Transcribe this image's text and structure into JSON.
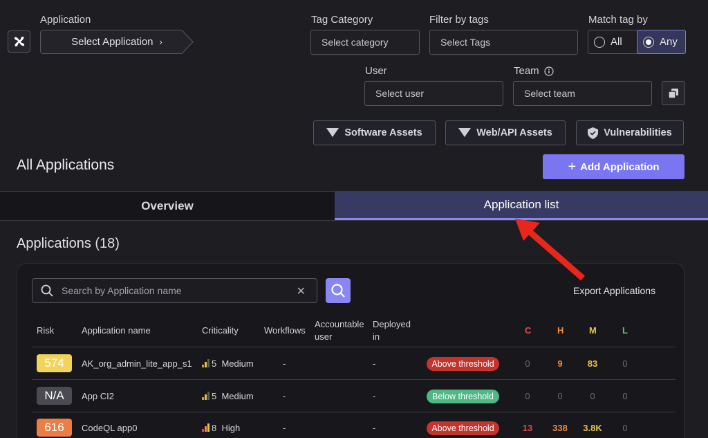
{
  "filters": {
    "application_label": "Application",
    "application_value": "Select Application",
    "tag_category_label": "Tag Category",
    "tag_category_placeholder": "Select category",
    "filter_tags_label": "Filter by tags",
    "filter_tags_placeholder": "Select Tags",
    "match_label": "Match tag by",
    "match_all": "All",
    "match_any": "Any",
    "user_label": "User",
    "user_placeholder": "Select user",
    "team_label": "Team",
    "team_placeholder": "Select team"
  },
  "asset_buttons": {
    "software": "Software Assets",
    "webapi": "Web/API Assets",
    "vulns": "Vulnerabilities"
  },
  "page_title": "All Applications",
  "add_button": "Add Application",
  "tabs": {
    "overview": "Overview",
    "app_list": "Application list"
  },
  "section_title": "Applications (18)",
  "search": {
    "placeholder": "Search by Application name"
  },
  "export_label": "Export Applications",
  "columns": {
    "risk": "Risk",
    "name": "Application name",
    "criticality": "Criticality",
    "workflows": "Workflows",
    "accountable_1": "Accountable",
    "accountable_2": "user",
    "deployed_1": "Deployed",
    "deployed_2": "in",
    "c": "C",
    "h": "H",
    "m": "M",
    "l": "L"
  },
  "rows": [
    {
      "risk": "574",
      "name": "AK_org_admin_lite_app_s1",
      "crit_num": "5",
      "crit_label": "Medium",
      "workflows": "-",
      "deployed": "-",
      "status": "Above threshold",
      "c": "0",
      "h": "9",
      "m": "83",
      "l": "0"
    },
    {
      "risk": "N/A",
      "name": "App CI2",
      "crit_num": "5",
      "crit_label": "Medium",
      "workflows": "-",
      "deployed": "-",
      "status": "Below threshold",
      "c": "0",
      "h": "0",
      "m": "0",
      "l": "0"
    },
    {
      "risk": "616",
      "name": "CodeQL app0",
      "crit_num": "8",
      "crit_label": "High",
      "workflows": "-",
      "deployed": "-",
      "status": "Above threshold",
      "c": "13",
      "h": "338",
      "m": "3.8K",
      "l": "0"
    }
  ],
  "colors": {
    "accent": "#7a76f2",
    "critical": "#e5484d",
    "high": "#f08a3c",
    "medium": "#e8c34a",
    "low": "#5fbf7a",
    "above_threshold": "#c4332c",
    "below_threshold": "#4fb884",
    "annotation_arrow": "#e8271c"
  }
}
